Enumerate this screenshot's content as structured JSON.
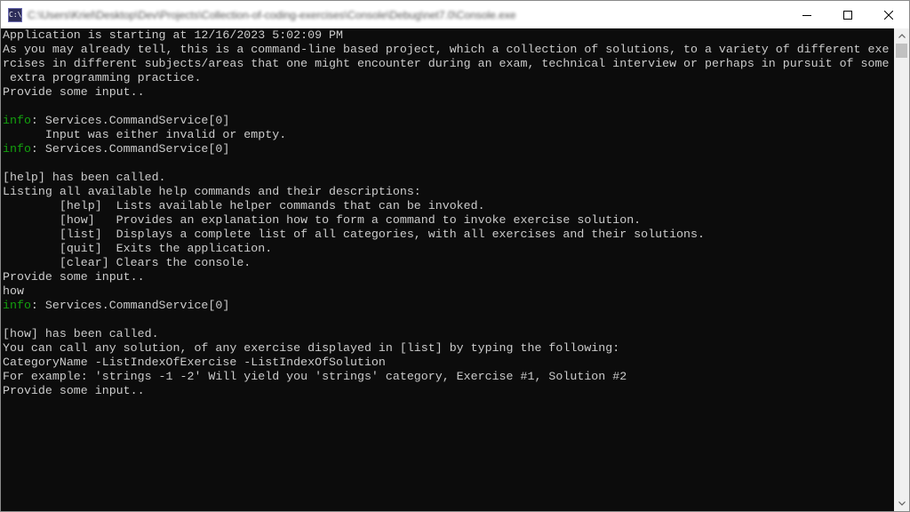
{
  "window": {
    "title": "C:\\Users\\Kriel\\Desktop\\Dev\\Projects\\Collection-of-coding-exercises\\Console\\Debug\\net7.0\\Console.exe",
    "app_icon_glyph": "C:\\"
  },
  "console": {
    "lines": [
      {
        "text": "Application is starting at 12/16/2023 5:02:09 PM"
      },
      {
        "text": "As you may already tell, this is a command-line based project, which a collection of solutions, to a variety of different exe"
      },
      {
        "text": "rcises in different subjects/areas that one might encounter during an exam, technical interview or perhaps in pursuit of some"
      },
      {
        "text": " extra programming practice."
      },
      {
        "text": "Provide some input.."
      },
      {
        "text": ""
      },
      {
        "prefix": "info",
        "text": ": Services.CommandService[0]"
      },
      {
        "text": "      Input was either invalid or empty."
      },
      {
        "prefix": "info",
        "text": ": Services.CommandService[0]"
      },
      {
        "text": ""
      },
      {
        "text": "[help] has been called."
      },
      {
        "text": "Listing all available help commands and their descriptions:"
      },
      {
        "text": "        [help]  Lists available helper commands that can be invoked."
      },
      {
        "text": "        [how]   Provides an explanation how to form a command to invoke exercise solution."
      },
      {
        "text": "        [list]  Displays a complete list of all categories, with all exercises and their solutions."
      },
      {
        "text": "        [quit]  Exits the application."
      },
      {
        "text": "        [clear] Clears the console."
      },
      {
        "text": "Provide some input.."
      },
      {
        "text": "how"
      },
      {
        "prefix": "info",
        "text": ": Services.CommandService[0]"
      },
      {
        "text": ""
      },
      {
        "text": "[how] has been called."
      },
      {
        "text": "You can call any solution, of any exercise displayed in [list] by typing the following:"
      },
      {
        "text": "CategoryName -ListIndexOfExercise -ListIndexOfSolution"
      },
      {
        "text": "For example: 'strings -1 -2' Will yield you 'strings' category, Exercise #1, Solution #2"
      },
      {
        "text": "Provide some input.."
      }
    ]
  },
  "colors": {
    "console_bg": "#0c0c0c",
    "console_fg": "#cccccc",
    "info_prefix": "#13a10e"
  },
  "icons": {
    "app": "console-app-icon",
    "minimize": "minimize-icon",
    "maximize": "maximize-icon",
    "close": "close-icon",
    "scroll_up": "chevron-up-icon",
    "scroll_down": "chevron-down-icon"
  }
}
